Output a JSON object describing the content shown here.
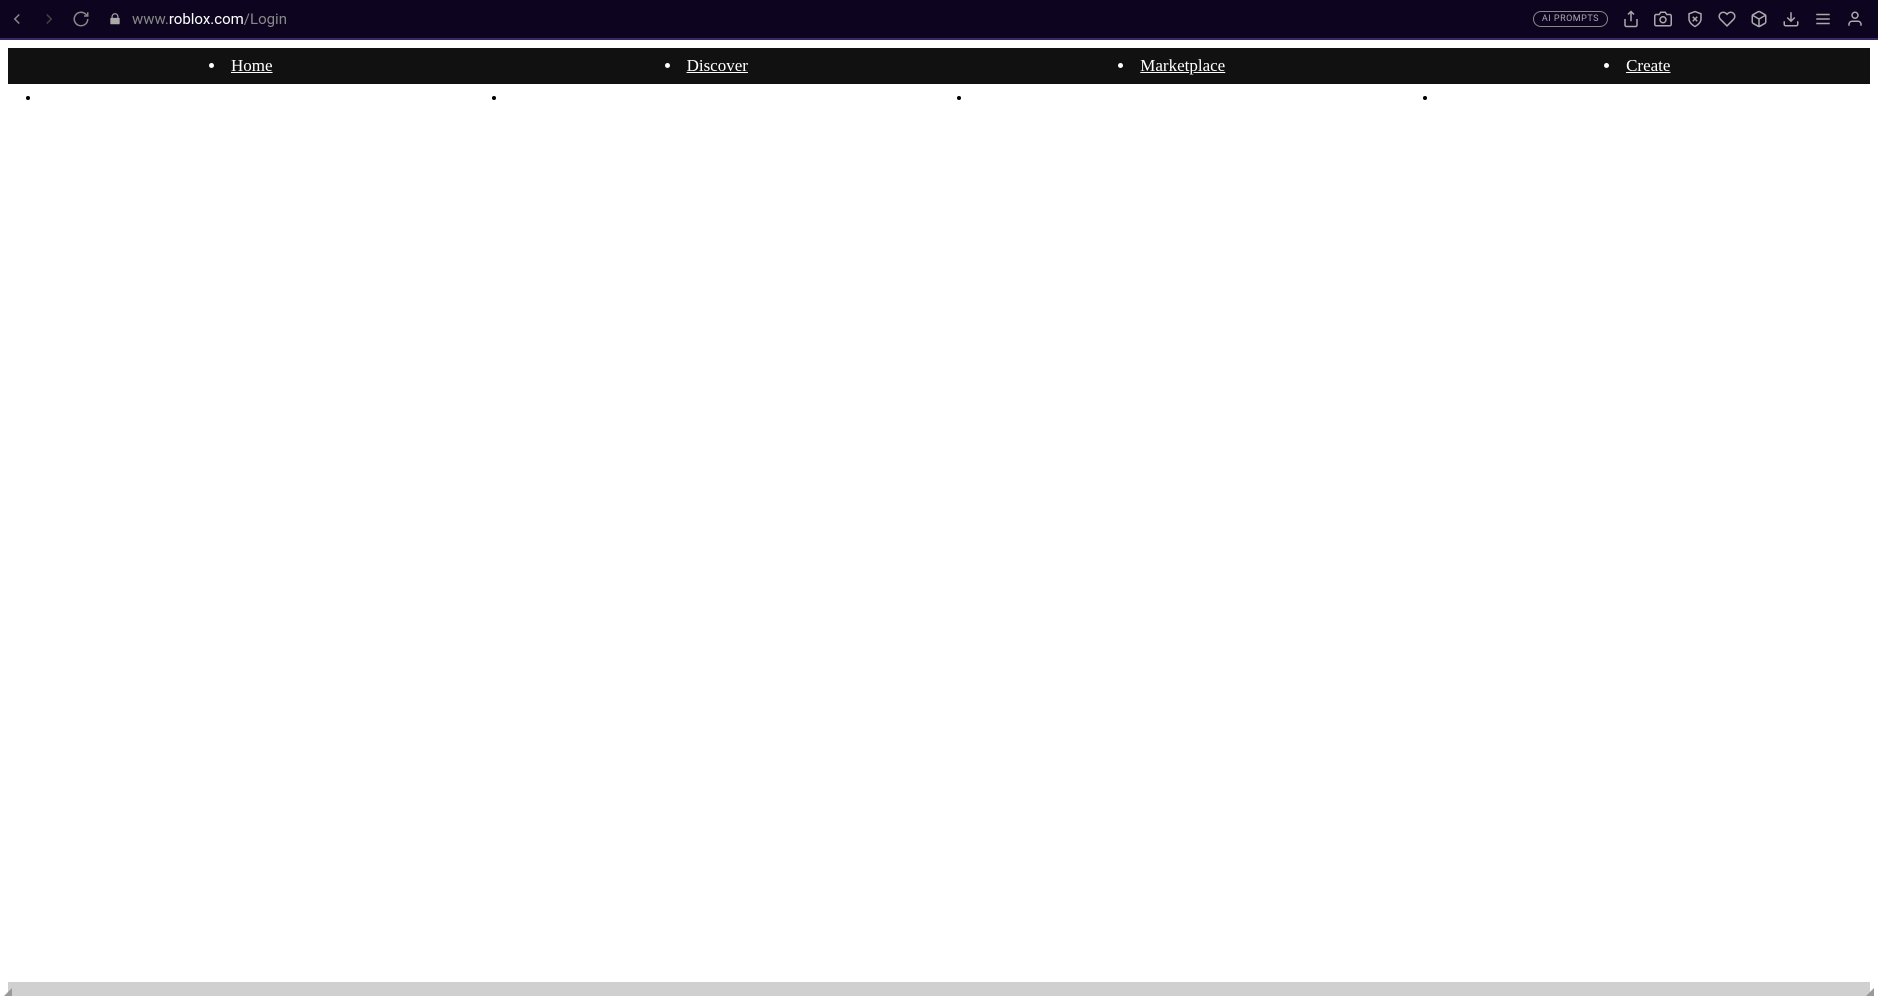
{
  "browser": {
    "url_subdomain": "www.",
    "url_domain": "roblox.com",
    "url_path": "/Login",
    "ai_prompts_label": "AI PROMPTS"
  },
  "nav": {
    "items": [
      {
        "label": "Home"
      },
      {
        "label": "Discover"
      },
      {
        "label": "Marketplace"
      },
      {
        "label": "Create"
      }
    ]
  }
}
